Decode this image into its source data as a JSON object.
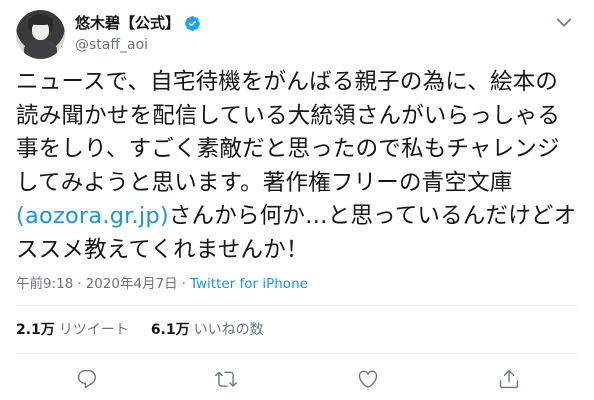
{
  "user": {
    "display_name": "悠木碧【公式】",
    "handle": "@staff_aoi"
  },
  "tweet": {
    "line1": "ニュースで、自宅待機をがんばる親子の為に、絵本の",
    "line2": "読み聞かせを配信している大統領さんがいらっしゃる",
    "line3": "事をしり、すごく素敵だと思ったので私もチャレンジ",
    "line4": "してみようと思います。著作権フリーの青空文庫",
    "line5_open": "(",
    "link_text": "aozora.gr.jp",
    "line5_close": ")",
    "line5_rest": "さんから何か…と思っているんだけどオ",
    "line6": "ススメ教えてくれませんか！"
  },
  "meta": {
    "time": "午前9:18",
    "separator1": "·",
    "date": "2020年4月7日",
    "separator2": "·",
    "source": "Twitter for iPhone"
  },
  "stats": {
    "retweets_count": "2.1万",
    "retweets_label": "リツイート",
    "likes_count": "6.1万",
    "likes_label": "いいねの数"
  },
  "icons": {
    "verified": "verified-badge-icon",
    "caret": "chevron-down-icon",
    "reply": "reply-icon",
    "retweet": "retweet-icon",
    "like": "heart-icon",
    "share": "share-icon"
  },
  "colors": {
    "link": "#1b95e0",
    "secondary_text": "#657786",
    "primary_text": "#14171a",
    "verified": "#1da1f2"
  }
}
